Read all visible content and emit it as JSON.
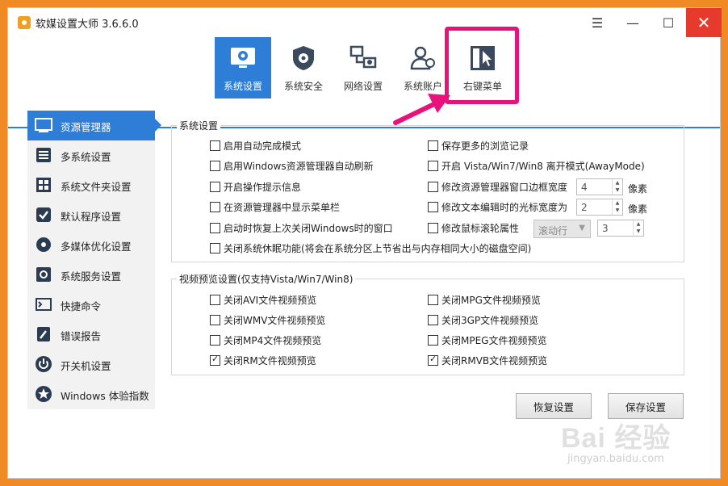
{
  "window": {
    "title": "软媒设置大师 3.6.6.0"
  },
  "controls": {
    "menu": "☰",
    "minimize": "—",
    "maximize": "☐",
    "close": "✕"
  },
  "toolbar": [
    {
      "label": "系统设置",
      "icon": "monitor-gear-icon",
      "active": true
    },
    {
      "label": "系统安全",
      "icon": "shield-gear-icon",
      "active": false
    },
    {
      "label": "网络设置",
      "icon": "network-icon",
      "active": false
    },
    {
      "label": "系统账户",
      "icon": "users-icon",
      "active": false
    },
    {
      "label": "右键菜单",
      "icon": "context-menu-icon",
      "active": false
    }
  ],
  "sidebar": [
    {
      "label": "资源管理器",
      "icon": "explorer-icon",
      "active": true
    },
    {
      "label": "多系统设置",
      "icon": "multi-system-icon",
      "active": false
    },
    {
      "label": "系统文件夹设置",
      "icon": "windows-folder-icon",
      "active": false
    },
    {
      "label": "默认程序设置",
      "icon": "check-shield-icon",
      "active": false
    },
    {
      "label": "多媒体优化设置",
      "icon": "media-icon",
      "active": false
    },
    {
      "label": "系统服务设置",
      "icon": "service-gear-icon",
      "active": false
    },
    {
      "label": "快捷命令",
      "icon": "command-icon",
      "active": false
    },
    {
      "label": "错误报告",
      "icon": "report-icon",
      "active": false
    },
    {
      "label": "开关机设置",
      "icon": "power-icon",
      "active": false
    },
    {
      "label": "Windows 体验指数",
      "icon": "star-icon",
      "active": false
    }
  ],
  "system_group": {
    "title": "系统设置",
    "options": [
      {
        "label": "启用自动完成模式",
        "checked": false
      },
      {
        "label": "保存更多的浏览记录",
        "checked": false
      },
      {
        "label": "启用Windows资源管理器自动刷新",
        "checked": false
      },
      {
        "label": "开启 Vista/Win7/Win8 离开模式(AwayMode)",
        "checked": false
      },
      {
        "label": "开启操作提示信息",
        "checked": false
      },
      {
        "label": "修改资源管理器窗口边框宽度",
        "checked": false
      },
      {
        "label": "在资源管理器中显示菜单栏",
        "checked": false
      },
      {
        "label": "修改文本编辑时的光标宽度为",
        "checked": false
      },
      {
        "label": "启动时恢复上次关闭Windows时的窗口",
        "checked": false
      },
      {
        "label": "修改鼠标滚轮属性",
        "checked": false
      },
      {
        "label": "关闭系统休眠功能(将会在系统分区上节省出与内存相同大小的磁盘空间)",
        "checked": false
      }
    ],
    "border_width": "4",
    "cursor_width": "2",
    "unit": "像素",
    "scroll_mode": "滚动行",
    "scroll_lines": "3"
  },
  "video_group": {
    "title": "视频预览设置(仅支持Vista/Win7/Win8)",
    "options": [
      {
        "label": "关闭AVI文件视频预览",
        "checked": false
      },
      {
        "label": "关闭MPG文件视频预览",
        "checked": false
      },
      {
        "label": "关闭WMV文件视频预览",
        "checked": false
      },
      {
        "label": "关闭3GP文件视频预览",
        "checked": false
      },
      {
        "label": "关闭MP4文件视频预览",
        "checked": false
      },
      {
        "label": "关闭MPEG文件视频预览",
        "checked": false
      },
      {
        "label": "关闭RM文件视频预览",
        "checked": true
      },
      {
        "label": "关闭RMVB文件视频预览",
        "checked": true
      }
    ]
  },
  "buttons": {
    "restore": "恢复设置",
    "save": "保存设置"
  },
  "watermark": {
    "main": "Bai 经验",
    "sub": "jingyan.baidu.com"
  },
  "colors": {
    "accent": "#2e7ed8",
    "highlight": "#e8127a",
    "frame": "#f08a24",
    "close": "#e63b2c"
  }
}
